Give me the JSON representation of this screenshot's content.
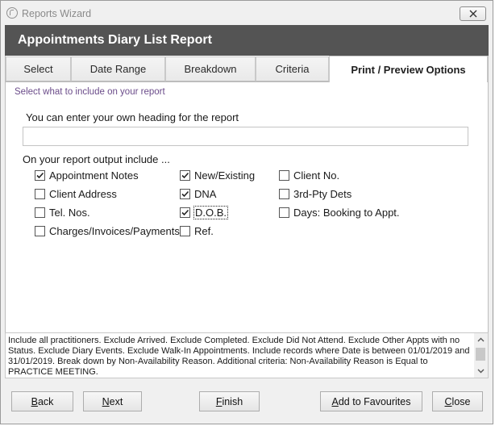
{
  "window": {
    "title": "Reports Wizard",
    "report_title": "Appointments Diary List Report"
  },
  "tabs": [
    {
      "label": "Select",
      "active": false
    },
    {
      "label": "Date Range",
      "active": false
    },
    {
      "label": "Breakdown",
      "active": false
    },
    {
      "label": "Criteria",
      "active": false
    },
    {
      "label": "Print / Preview Options",
      "active": true
    }
  ],
  "options": {
    "instruction": "Select what to include on your report",
    "heading_label": "You can enter your own heading for the report",
    "heading_value": "",
    "output_label": "On your report output include ...",
    "checkboxes": [
      {
        "label": "Appointment Notes",
        "checked": true
      },
      {
        "label": "New/Existing",
        "checked": true
      },
      {
        "label": "Client No.",
        "checked": false
      },
      {
        "label": "Client Address",
        "checked": false
      },
      {
        "label": "DNA",
        "checked": true
      },
      {
        "label": "3rd-Pty Dets",
        "checked": false
      },
      {
        "label": "Tel. Nos.",
        "checked": false
      },
      {
        "label": "D.O.B.",
        "checked": true
      },
      {
        "label": "Days: Booking to Appt.",
        "checked": false
      },
      {
        "label": "Charges/Invoices/Payments",
        "checked": false
      },
      {
        "label": "Ref.",
        "checked": false
      }
    ]
  },
  "summary": {
    "text": "Include all practitioners. Exclude Arrived. Exclude Completed. Exclude Did Not Attend. Exclude Other Appts with no Status. Exclude Diary Events. Exclude Walk-In Appointments. Include records where Date is between 01/01/2019 and 31/01/2019. Break down by Non-Availability Reason. Additional criteria: Non-Availability Reason is Equal to PRACTICE MEETING."
  },
  "buttons": {
    "back": {
      "first": "B",
      "rest": "ack"
    },
    "next": {
      "first": "N",
      "rest": "ext"
    },
    "finish": {
      "first": "F",
      "rest": "inish"
    },
    "add_to_favourites": {
      "first": "A",
      "rest": "dd to Favourites"
    },
    "close": {
      "first": "C",
      "rest": "lose"
    }
  },
  "icons": {
    "app": "reports-wizard-icon",
    "close": "close-icon",
    "scroll_up": "chevron-up-icon",
    "scroll_down": "chevron-down-icon",
    "check": "checkmark-icon"
  }
}
